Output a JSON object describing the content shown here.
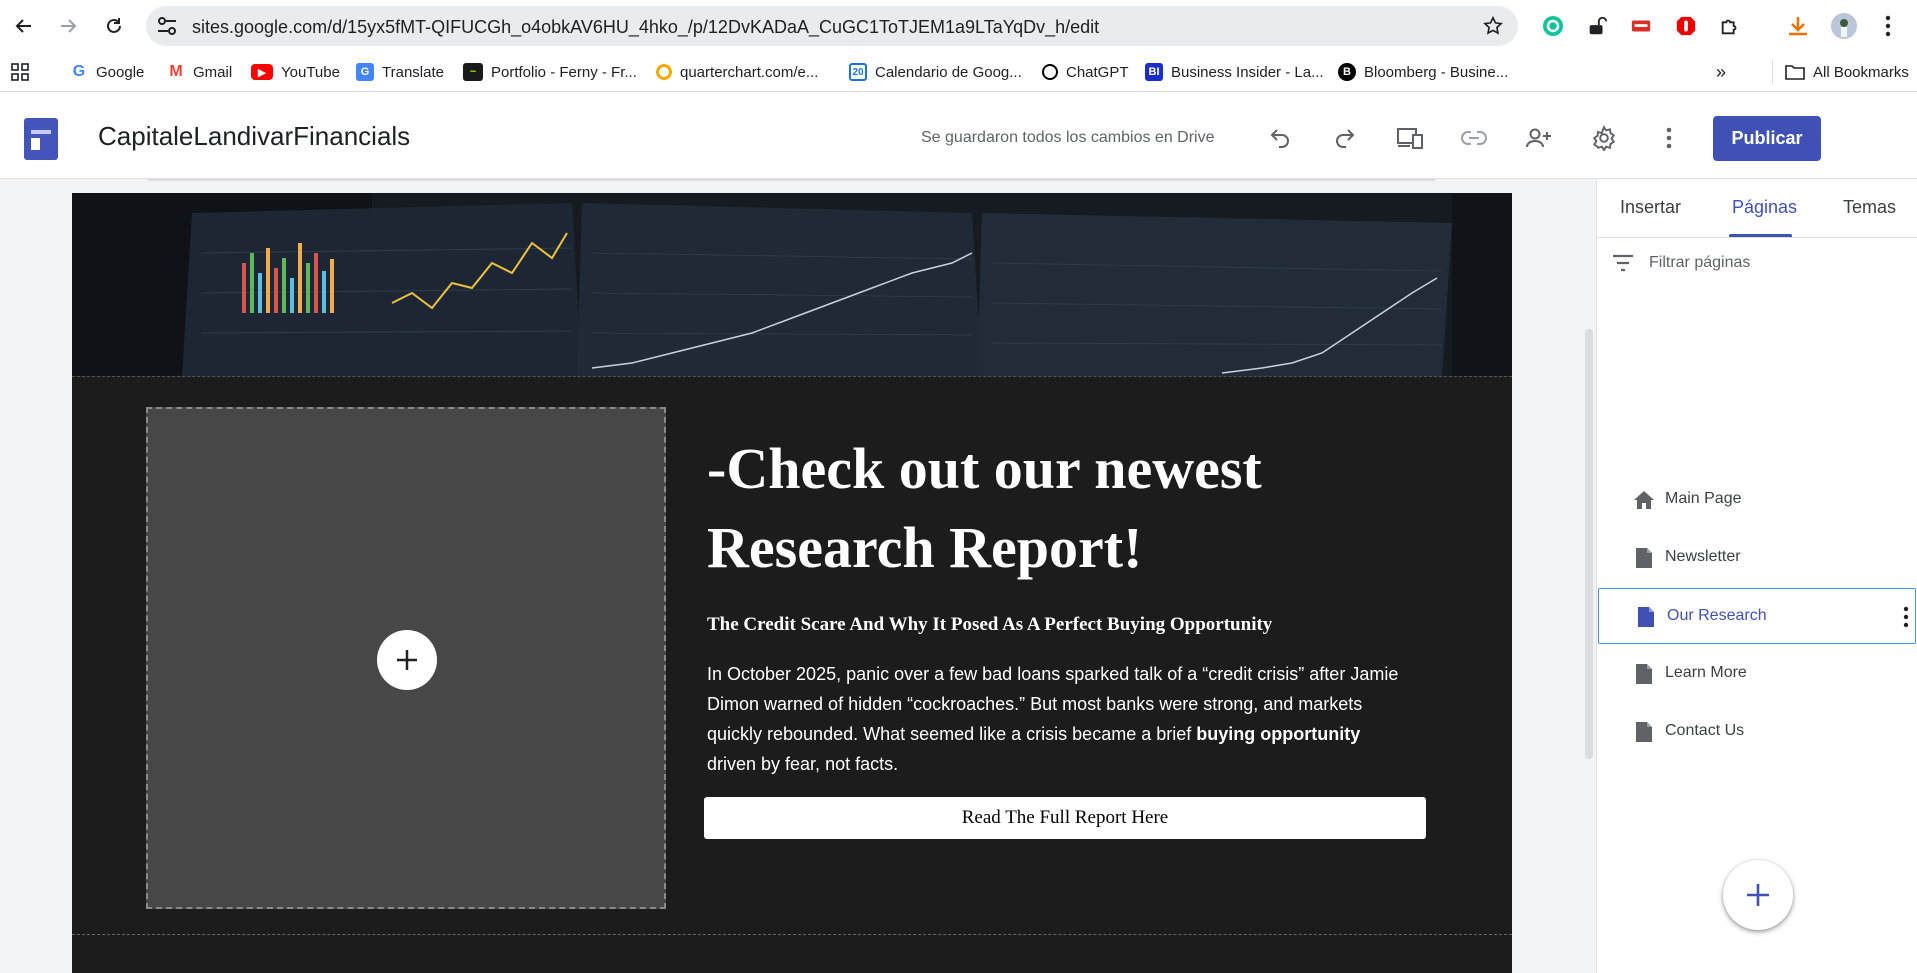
{
  "browser": {
    "url": "sites.google.com/d/15yx5fMT-QIFUCGh_o4obkAV6HU_4hko_/p/12DvKADaA_CuGC1ToTJEM1a9LTaYqDv_h/edit",
    "bookmarks": [
      {
        "label": "Google",
        "icon": "google-icon",
        "color": "#4285f4"
      },
      {
        "label": "Gmail",
        "icon": "gmail-icon",
        "color": "#ea4335"
      },
      {
        "label": "YouTube",
        "icon": "youtube-icon",
        "color": "#ff0000"
      },
      {
        "label": "Translate",
        "icon": "translate-icon",
        "color": "#4285f4"
      },
      {
        "label": "Portfolio - Ferny - Fr...",
        "icon": "portfolio-icon",
        "color": "#1a1a1a"
      },
      {
        "label": "quarterchart.com/e...",
        "icon": "quarterchart-icon",
        "color": "#f2a900"
      },
      {
        "label": "Calendario de Goog...",
        "icon": "calendar-icon",
        "color": "#1a73e8"
      },
      {
        "label": "ChatGPT",
        "icon": "chatgpt-icon",
        "color": "#000000"
      },
      {
        "label": "Business Insider - La...",
        "icon": "business-insider-icon",
        "color": "#1a2dc9"
      },
      {
        "label": "Bloomberg - Busine...",
        "icon": "bloomberg-icon",
        "color": "#000000"
      }
    ],
    "all_bookmarks": "All Bookmarks"
  },
  "header": {
    "site_title": "CapitaleLandivarFinancials",
    "save_status": "Se guardaron todos los cambios en Drive",
    "publish_label": "Publicar",
    "accent": "#3f51b5"
  },
  "content": {
    "headline": "-Check out our newest Research Report!",
    "subhead": "The Credit Scare And Why It Posed As A Perfect Buying Opportunity",
    "body_part1": "In October 2025, panic over a few bad loans sparked talk of a “credit crisis” after Jamie Dimon warned of hidden “cockroaches.” But most banks were strong, and markets quickly rebounded. What seemed like a crisis became a brief ",
    "body_bold": "buying opportunity",
    "body_part2": " driven by fear, not facts.",
    "cta_label": "Read The Full Report Here"
  },
  "panel": {
    "tabs": [
      {
        "label": "Insertar"
      },
      {
        "label": "Páginas"
      },
      {
        "label": "Temas"
      }
    ],
    "active_tab": "Páginas",
    "filter_placeholder": "Filtrar páginas",
    "pages": [
      {
        "label": "Main Page",
        "icon": "home-icon"
      },
      {
        "label": "Newsletter",
        "icon": "page-icon"
      },
      {
        "label": "Our Research",
        "icon": "page-icon",
        "selected": true
      },
      {
        "label": "Learn More",
        "icon": "page-icon"
      },
      {
        "label": "Contact Us",
        "icon": "page-icon"
      }
    ]
  }
}
